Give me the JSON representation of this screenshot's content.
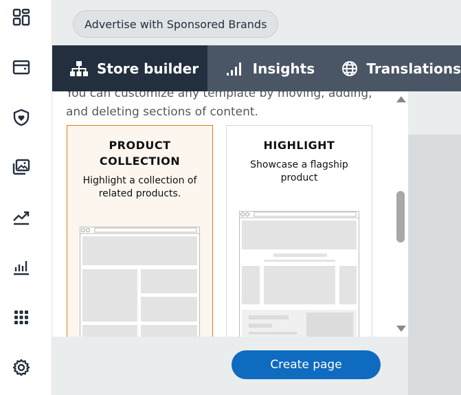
{
  "sidebar": {
    "icons": [
      "dashboard-icon",
      "wallet-icon",
      "shield-heart-icon",
      "media-gallery-icon",
      "trend-chart-icon",
      "bar-chart-icon",
      "apps-grid-icon",
      "settings-gear-icon"
    ]
  },
  "header": {
    "pill_label": "Advertise with Sponsored Brands"
  },
  "tabs": [
    {
      "label": "Store builder",
      "icon": "sitemap-icon",
      "active": true
    },
    {
      "label": "Insights",
      "icon": "signal-bars-icon",
      "active": false
    },
    {
      "label": "Translations",
      "icon": "globe-icon",
      "active": false
    }
  ],
  "panel": {
    "description": "You can customize any template by moving, adding, and deleting sections of content.",
    "cards": [
      {
        "title": "PRODUCT COLLECTION",
        "description": "Highlight a collection of related products.",
        "selected": true
      },
      {
        "title": "HIGHLIGHT",
        "description": "Showcase a flagship product",
        "selected": false
      }
    ]
  },
  "footer": {
    "create_label": "Create page"
  },
  "colors": {
    "tab_active": "#232f3e",
    "tab_bar": "#4a5566",
    "selected_border": "#e47911",
    "primary_button": "#0e6bbf"
  }
}
